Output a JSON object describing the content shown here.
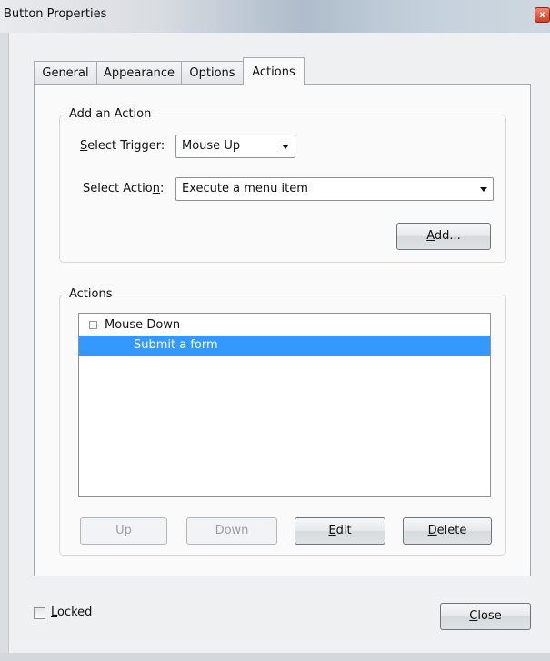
{
  "window": {
    "title": "Button Properties",
    "close_glyph": "x"
  },
  "tabs": [
    {
      "label": "General",
      "active": false
    },
    {
      "label": "Appearance",
      "active": false
    },
    {
      "label": "Options",
      "active": false
    },
    {
      "label": "Actions",
      "active": true
    }
  ],
  "add_action": {
    "legend": "Add an Action",
    "trigger_label": {
      "mnemonic": "S",
      "rest": "elect Trigger:"
    },
    "trigger_value": "Mouse Up",
    "action_label": {
      "pre": "Select Actio",
      "mnemonic": "n",
      "post": ":"
    },
    "action_value": "Execute a menu item",
    "add_button": {
      "mnemonic": "A",
      "rest": "dd..."
    }
  },
  "actions": {
    "legend": "Actions",
    "tree": [
      {
        "label": "Mouse Down",
        "level": 0,
        "expanded": true,
        "selected": false
      },
      {
        "label": "Submit a form",
        "level": 1,
        "selected": true
      }
    ],
    "buttons": {
      "up": {
        "label": "Up",
        "enabled": false
      },
      "down": {
        "label": "Down",
        "enabled": false
      },
      "edit": {
        "mnemonic": "E",
        "rest": "dit",
        "enabled": true
      },
      "delete": {
        "mnemonic": "D",
        "rest": "elete",
        "enabled": true
      }
    }
  },
  "footer": {
    "locked": {
      "mnemonic": "L",
      "rest": "ocked",
      "checked": false
    },
    "close": {
      "mnemonic": "C",
      "rest": "lose"
    }
  },
  "colors": {
    "selection": "#3399ff",
    "close_button": "#cf3f26"
  }
}
